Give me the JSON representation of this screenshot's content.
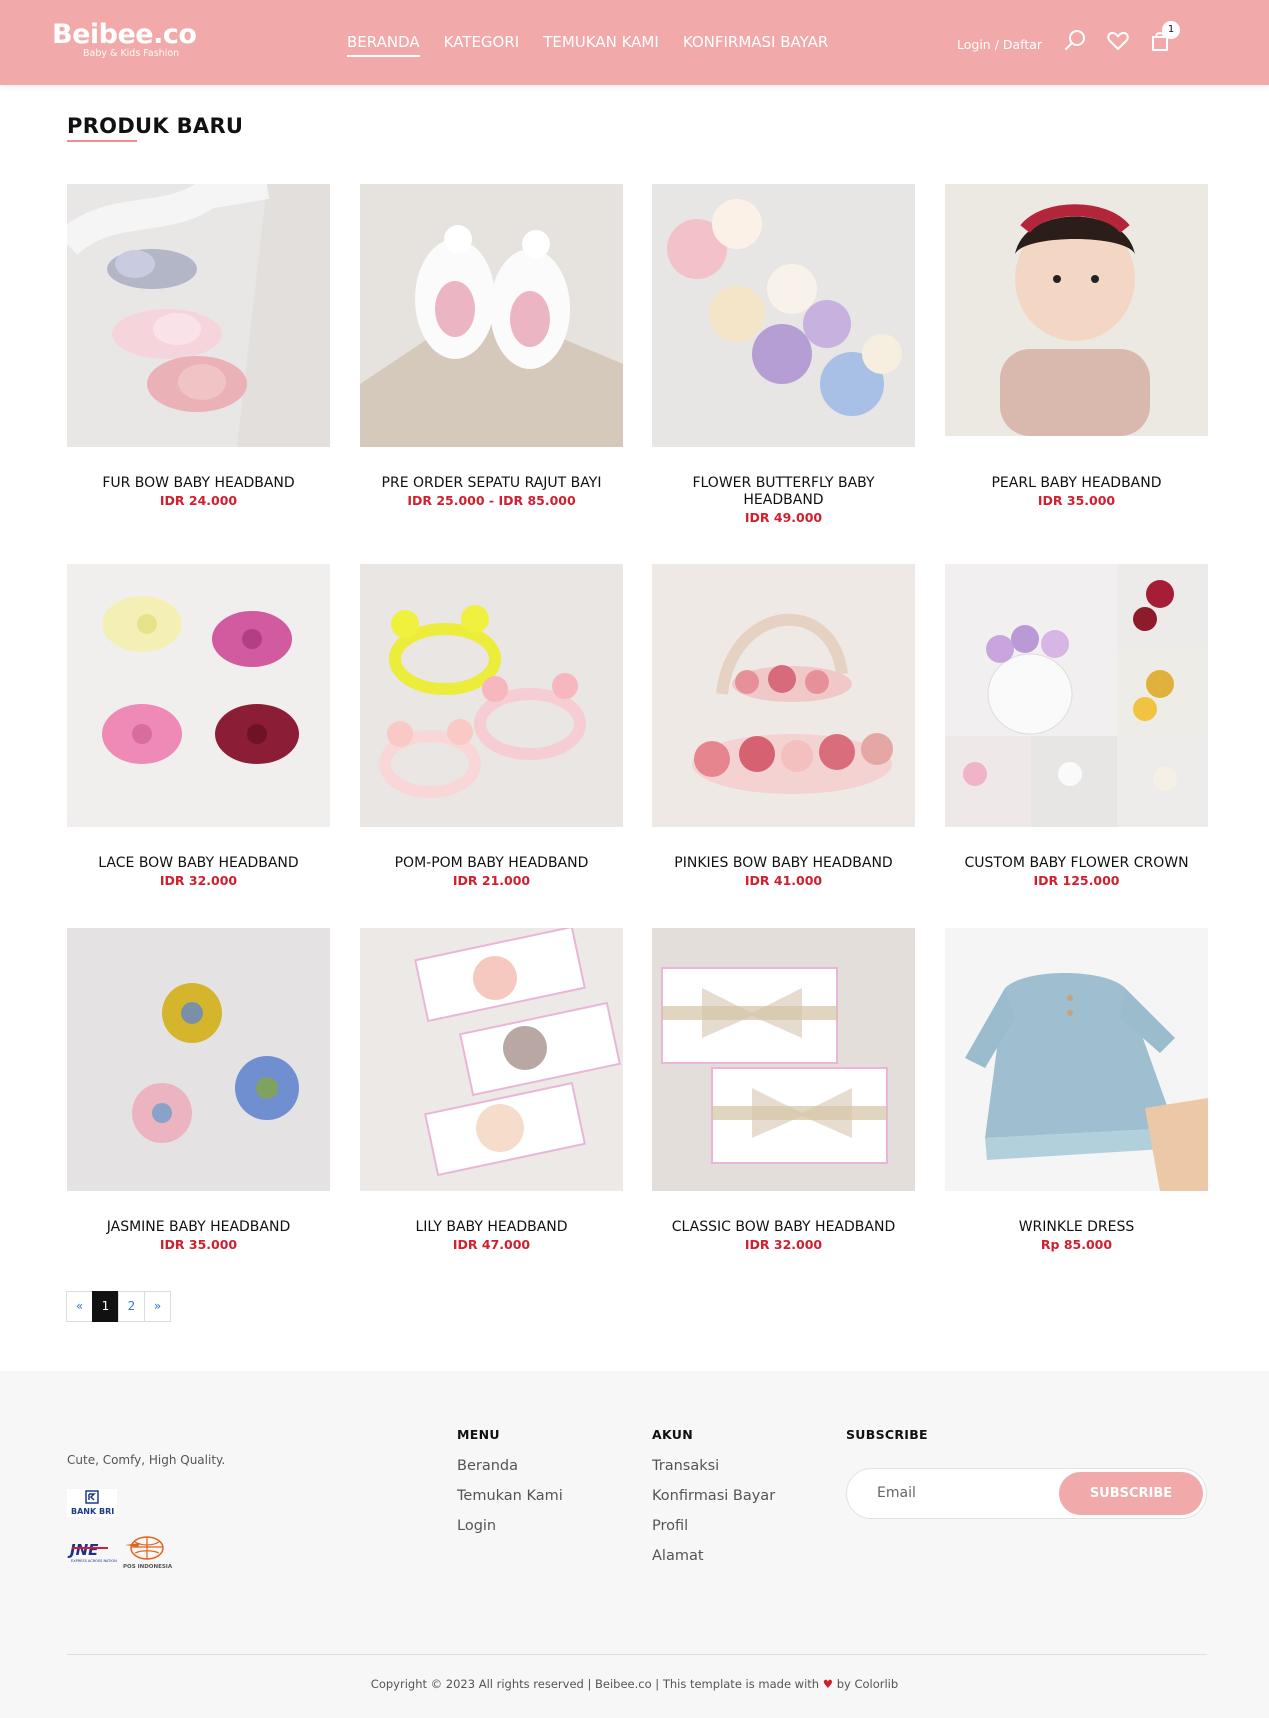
{
  "header": {
    "logo_title": "Beibee.co",
    "logo_tagline": "Baby & Kids Fashion",
    "nav": [
      "BERANDA",
      "KATEGORI",
      "TEMUKAN KAMI",
      "KONFIRMASI BAYAR"
    ],
    "login_label": "Login / Daftar",
    "cart_count": "1",
    "icons": [
      "search-icon",
      "heart-icon",
      "shopping-bag-icon"
    ],
    "brand_color": "#f2a9a9"
  },
  "section": {
    "title": "PRODUK BARU"
  },
  "products": [
    {
      "name": "FUR BOW BABY HEADBAND",
      "price": "IDR 24.000"
    },
    {
      "name": "PRE ORDER SEPATU RAJUT BAYI",
      "price": "IDR 25.000 - IDR 85.000"
    },
    {
      "name": "FLOWER BUTTERFLY BABY HEADBAND",
      "price": "IDR 49.000"
    },
    {
      "name": "PEARL BABY HEADBAND",
      "price": "IDR 35.000"
    },
    {
      "name": "LACE BOW BABY HEADBAND",
      "price": "IDR 32.000"
    },
    {
      "name": "POM-POM BABY HEADBAND",
      "price": "IDR 21.000"
    },
    {
      "name": "PINKIES BOW BABY HEADBAND",
      "price": "IDR 41.000"
    },
    {
      "name": "CUSTOM BABY FLOWER CROWN",
      "price": "IDR 125.000"
    },
    {
      "name": "JASMINE BABY HEADBAND",
      "price": "IDR 35.000"
    },
    {
      "name": "LILY BABY HEADBAND",
      "price": "IDR 47.000"
    },
    {
      "name": "CLASSIC BOW BABY HEADBAND",
      "price": "IDR 32.000"
    },
    {
      "name": "WRINKLE DRESS",
      "price": "Rp 85.000"
    }
  ],
  "pagination": {
    "prev": "«",
    "pages": [
      "1",
      "2"
    ],
    "next": "»",
    "current": "1"
  },
  "footer": {
    "tagline": "Cute, Comfy, High Quality.",
    "bank_logo_text": "BANK BRI",
    "courier_logos": [
      "JNE",
      "POS INDONESIA"
    ],
    "menu": {
      "title": "MENU",
      "items": [
        "Beranda",
        "Temukan Kami",
        "Login"
      ]
    },
    "account": {
      "title": "AKUN",
      "items": [
        "Transaksi",
        "Konfirmasi Bayar",
        "Profil",
        "Alamat"
      ]
    },
    "subscribe": {
      "title": "SUBSCRIBE",
      "placeholder": "Email",
      "button": "SUBSCRIBE"
    },
    "copyright_pre": "Copyright © 2023 All rights reserved | Beibee.co | This template is made with",
    "copyright_post": "by Colorlib",
    "price_color": "#d11f2e"
  }
}
